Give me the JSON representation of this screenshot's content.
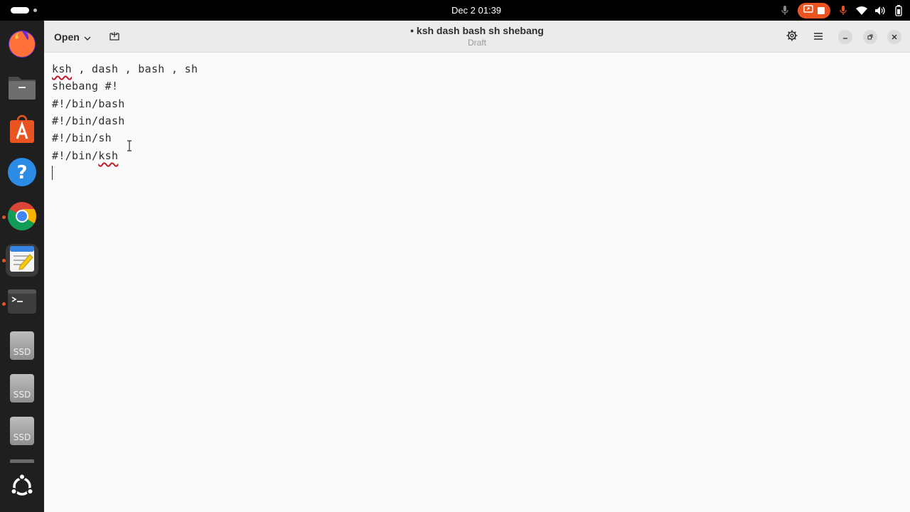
{
  "topbar": {
    "clock": "Dec 2  01:39"
  },
  "dock": {
    "apps": [
      {
        "name": "Firefox",
        "icon": "firefox-icon"
      },
      {
        "name": "Files",
        "icon": "files-icon"
      },
      {
        "name": "App Center",
        "icon": "app-center-icon"
      },
      {
        "name": "Help",
        "icon": "help-icon"
      },
      {
        "name": "Google Chrome",
        "icon": "chrome-icon"
      },
      {
        "name": "Text Editor",
        "icon": "text-editor-icon"
      },
      {
        "name": "Terminal",
        "icon": "terminal-icon"
      }
    ],
    "drives": [
      "SSD",
      "SSD",
      "SSD"
    ],
    "accent": "#e95420"
  },
  "headerbar": {
    "open_label": "Open",
    "title": "• ksh dash bash sh shebang",
    "subtitle": "Draft"
  },
  "editor": {
    "lines": [
      {
        "parts": [
          {
            "text": "ksh",
            "misspelled": true
          },
          {
            "text": " , dash , bash , sh",
            "misspelled": false
          }
        ]
      },
      {
        "parts": [
          {
            "text": "shebang #!",
            "misspelled": false
          }
        ]
      },
      {
        "parts": [
          {
            "text": "#!/bin/bash",
            "misspelled": false
          }
        ]
      },
      {
        "parts": [
          {
            "text": "#!/bin/dash",
            "misspelled": false
          }
        ]
      },
      {
        "parts": [
          {
            "text": "#!/bin/sh",
            "misspelled": false
          }
        ]
      },
      {
        "parts": [
          {
            "text": "#!/bin/",
            "misspelled": false
          },
          {
            "text": "ksh",
            "misspelled": true
          }
        ]
      }
    ]
  }
}
